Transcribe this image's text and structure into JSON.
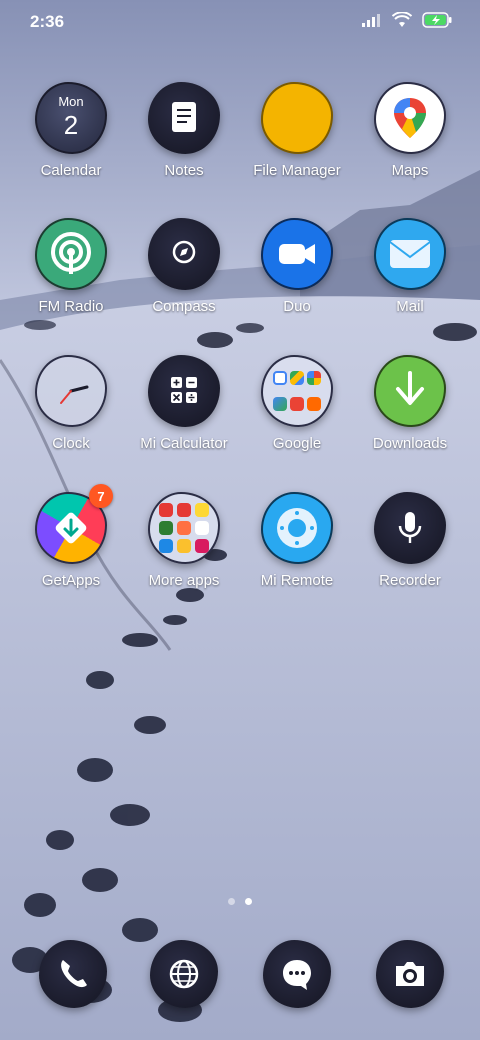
{
  "status_bar": {
    "time": "2:36"
  },
  "calendar": {
    "day": "Mon",
    "date": "2"
  },
  "apps": {
    "calendar": "Calendar",
    "notes": "Notes",
    "file_manager": "File Manager",
    "maps": "Maps",
    "fm_radio": "FM Radio",
    "compass": "Compass",
    "duo": "Duo",
    "mail": "Mail",
    "clock": "Clock",
    "calculator": "Mi Calculator",
    "google": "Google",
    "downloads": "Downloads",
    "getapps": "GetApps",
    "more_apps": "More apps",
    "mi_remote": "Mi Remote",
    "recorder": "Recorder"
  },
  "badges": {
    "getapps": "7"
  },
  "pages": {
    "count": 2,
    "active": 2
  },
  "dock": [
    "phone-icon",
    "browser-icon",
    "messages-icon",
    "camera-icon"
  ]
}
